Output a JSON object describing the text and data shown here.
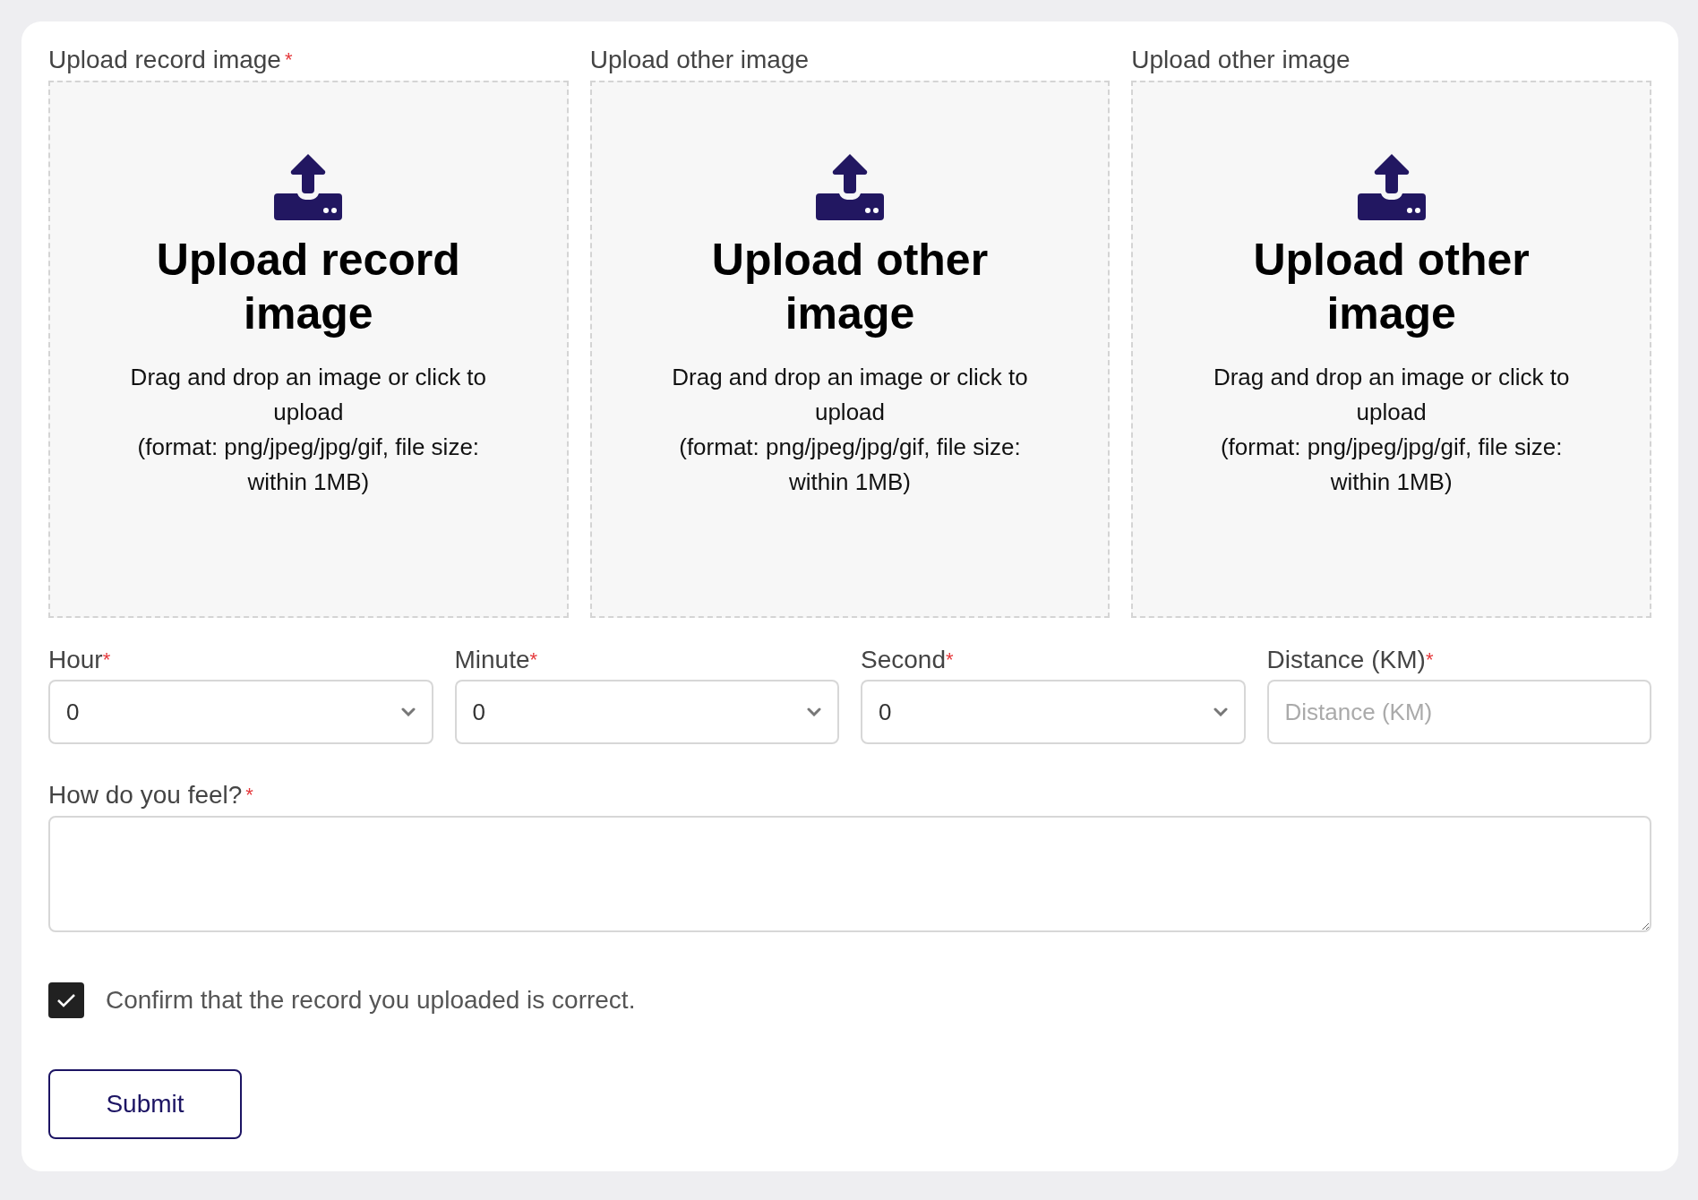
{
  "uploads": [
    {
      "label": "Upload record image",
      "required_mark": "*",
      "title": "Upload record image",
      "hint": "Drag and drop an image or click to upload",
      "format": "(format: png/jpeg/jpg/gif, file size: within 1MB)"
    },
    {
      "label": "Upload other image",
      "title": "Upload other image",
      "hint": "Drag and drop an image or click to upload",
      "format": "(format: png/jpeg/jpg/gif, file size: within 1MB)"
    },
    {
      "label": "Upload other image",
      "title": "Upload other image",
      "hint": "Drag and drop an image or click to upload",
      "format": "(format: png/jpeg/jpg/gif, file size: within 1MB)"
    }
  ],
  "fields": [
    {
      "kind": "select",
      "label": "Hour",
      "required_mark": "*",
      "value": "0"
    },
    {
      "kind": "select",
      "label": "Minute",
      "required_mark": "*",
      "value": "0"
    },
    {
      "kind": "select",
      "label": "Second",
      "required_mark": "*",
      "value": "0"
    },
    {
      "kind": "input",
      "label": "Distance (KM)",
      "required_mark": "*",
      "placeholder": "Distance (KM)"
    }
  ],
  "feeling": {
    "label": "How do you feel?",
    "required_mark": "*"
  },
  "confirm": {
    "label": "Confirm that the record you uploaded is correct.",
    "checked": true
  },
  "submit": {
    "label": "Submit"
  }
}
